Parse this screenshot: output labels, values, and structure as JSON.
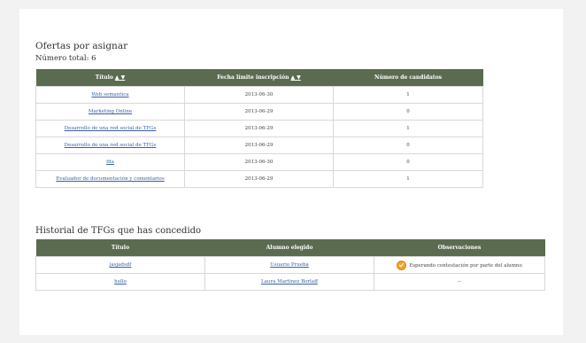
{
  "offers": {
    "title": "Ofertas por asignar",
    "total_label": "Número total: 6",
    "columns": [
      {
        "label": "Título",
        "sort": "▲ ▼"
      },
      {
        "label": "Fecha límite inscripción",
        "sort": "▲ ▼"
      },
      {
        "label": "Número de candidatos",
        "sort": ""
      }
    ],
    "rows": [
      {
        "title": "Web semantica",
        "date": "2013-06-30",
        "candidates": "1"
      },
      {
        "title": "Marketing Online",
        "date": "2013-06-29",
        "candidates": "0"
      },
      {
        "title": "Desarrollo de una red social de TFGs",
        "date": "2013-06-29",
        "candidates": "1"
      },
      {
        "title": "Desarrollo de una red social de TFGs",
        "date": "2013-06-29",
        "candidates": "0"
      },
      {
        "title": "fda",
        "date": "2013-06-30",
        "candidates": "0"
      },
      {
        "title": "Evaluador de documentación y comentarios",
        "date": "2013-06-29",
        "candidates": "1"
      }
    ]
  },
  "history": {
    "title": "Historial de TFGs que has concedido",
    "columns": [
      "Título",
      "Alumno elegido",
      "Observaciones"
    ],
    "rows": [
      {
        "title": "jasjadsdf",
        "student": "Usuario Prueba",
        "observation": "Esperando contestación por parte del alumno",
        "icon": "check-badge-icon"
      },
      {
        "title": "hello",
        "student": "Laura Martinez Borlaff",
        "observation": "--",
        "icon": ""
      }
    ]
  }
}
